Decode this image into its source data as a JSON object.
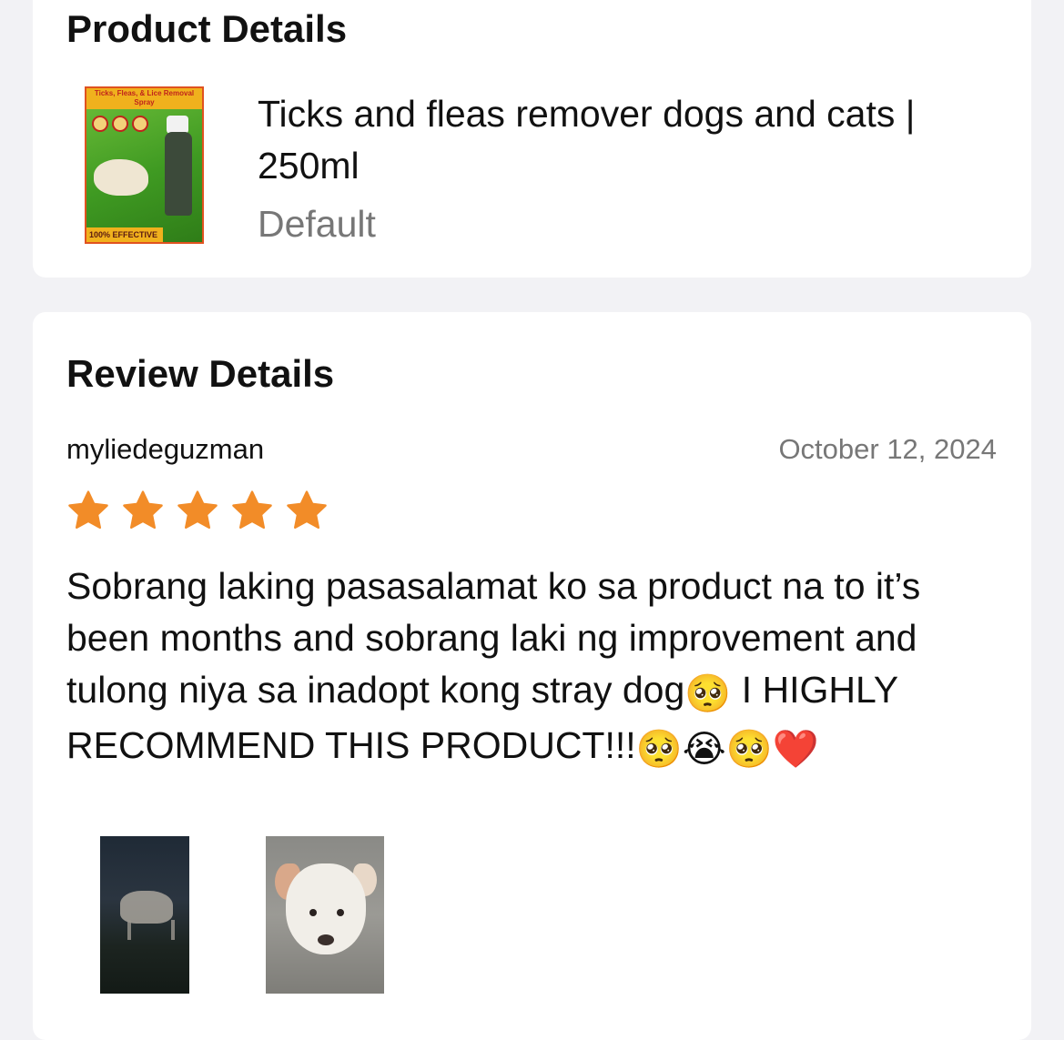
{
  "product_section": {
    "title": "Product Details",
    "product_name": "Ticks and fleas remover dogs and cats | 250ml",
    "variant": "Default",
    "thumbnail": {
      "banner_text": "Ticks, Fleas, & Lice Removal Spray",
      "badge_text": "100% EFFECTIVE"
    }
  },
  "review_section": {
    "title": "Review Details",
    "reviewer": "myliedeguzman",
    "date": "October 12, 2024",
    "rating": 5,
    "star_color": "#f28c28",
    "text_part1": "Sobrang laking pasasalamat ko sa product na to it’s been months and sobrang laki ng improvement and tulong niya sa inadopt kong stray dog",
    "emoji_1": "🥺",
    "text_part2": " I HIGHLY RECOMMEND THIS PRODUCT!!!",
    "emoji_2": "🥺",
    "emoji_3": "😭",
    "emoji_4": "🥺",
    "emoji_5": "❤️",
    "photos": [
      "dog-photo-night",
      "dog-photo-closeup"
    ]
  }
}
